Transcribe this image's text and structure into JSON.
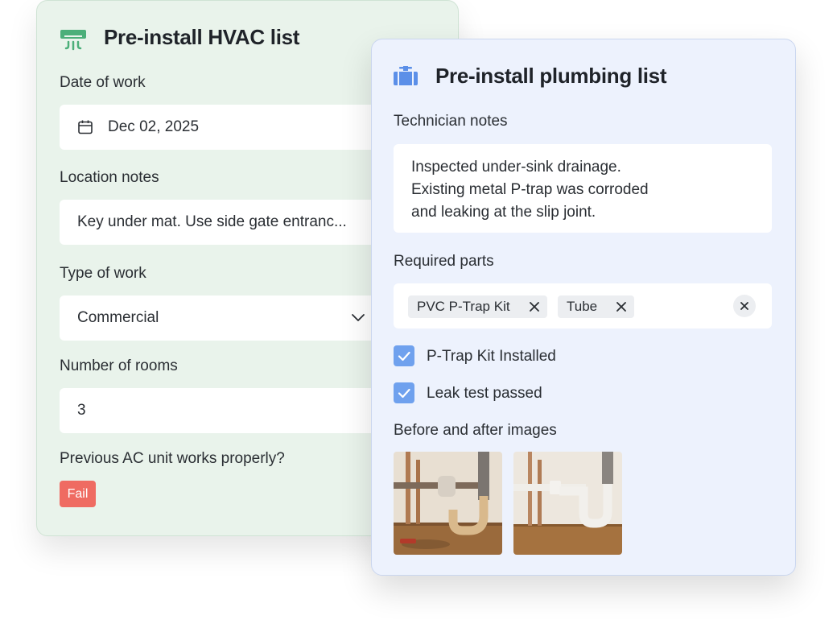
{
  "hvac": {
    "title": "Pre-install HVAC list",
    "icon": "air-conditioner-icon",
    "date_label": "Date of work",
    "date_value": "Dec 02, 2025",
    "location_label": "Location notes",
    "location_value": "Key under mat. Use side gate entranc...",
    "type_label": "Type of work",
    "type_value": "Commercial",
    "rooms_label": "Number of rooms",
    "rooms_value": "3",
    "ac_question": "Previous AC unit works properly?",
    "ac_answer": "Fail"
  },
  "plumbing": {
    "title": "Pre-install plumbing list",
    "icon": "pipe-icon",
    "notes_label": "Technician notes",
    "notes_lines": [
      "Inspected under-sink drainage.",
      "Existing metal P-trap was corroded",
      "and leaking at the slip joint."
    ],
    "parts_label": "Required parts",
    "parts": [
      "PVC P-Trap Kit",
      "Tube"
    ],
    "checks": [
      {
        "label": "P-Trap Kit Installed",
        "checked": true
      },
      {
        "label": "Leak test passed",
        "checked": true
      }
    ],
    "images_label": "Before and after images"
  },
  "colors": {
    "hvac_bg": "#e9f3eb",
    "plumb_bg": "#edf2fd",
    "fail": "#ef6b62",
    "checkbox": "#6fa1ee",
    "hvac_icon": "#4caf7a",
    "plumb_icon": "#5b8fe8"
  }
}
